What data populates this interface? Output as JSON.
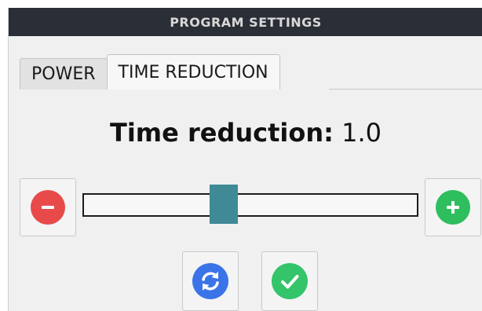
{
  "window": {
    "title": "PROGRAM SETTINGS"
  },
  "tabs": [
    {
      "label": "POWER",
      "active": false
    },
    {
      "label": "TIME REDUCTION",
      "active": true
    }
  ],
  "setting": {
    "label": "Time reduction:",
    "value": "1.0"
  },
  "slider": {
    "position_fraction": 0.42
  },
  "buttons": {
    "decrease_icon": "minus-icon",
    "increase_icon": "plus-icon",
    "reset_icon": "refresh-icon",
    "confirm_icon": "check-icon"
  },
  "colors": {
    "titlebar": "#2a2e36",
    "minus": "#e84a4a",
    "plus": "#2ebe5e",
    "reset": "#3b74e8",
    "confirm": "#34c46a",
    "slider_handle": "#3f8a96"
  }
}
